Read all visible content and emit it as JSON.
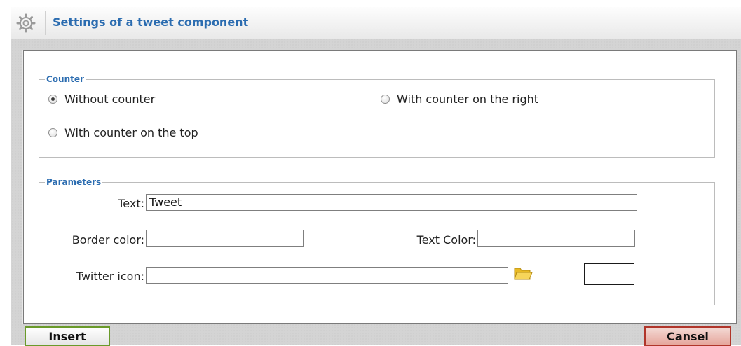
{
  "dialog": {
    "title": "Settings of a tweet component"
  },
  "counter": {
    "legend": "Counter",
    "options": [
      {
        "label": "Without counter",
        "checked": true
      },
      {
        "label": "With counter on the right",
        "checked": false
      },
      {
        "label": "With counter on the top",
        "checked": false
      }
    ]
  },
  "parameters": {
    "legend": "Parameters",
    "text_label": "Text:",
    "text_value": "Tweet",
    "border_color_label": "Border color:",
    "border_color_value": "",
    "text_color_label": "Text Color:",
    "text_color_value": "",
    "twitter_icon_label": "Twitter icon:",
    "twitter_icon_value": ""
  },
  "buttons": {
    "insert": "Insert",
    "cancel": "Cansel"
  },
  "colors": {
    "title": "#2b6cb0",
    "insert_border": "#6a9a2a",
    "cancel_border": "#b0352a"
  },
  "icons": {
    "title": "gear-icon",
    "browse": "folder-icon"
  }
}
